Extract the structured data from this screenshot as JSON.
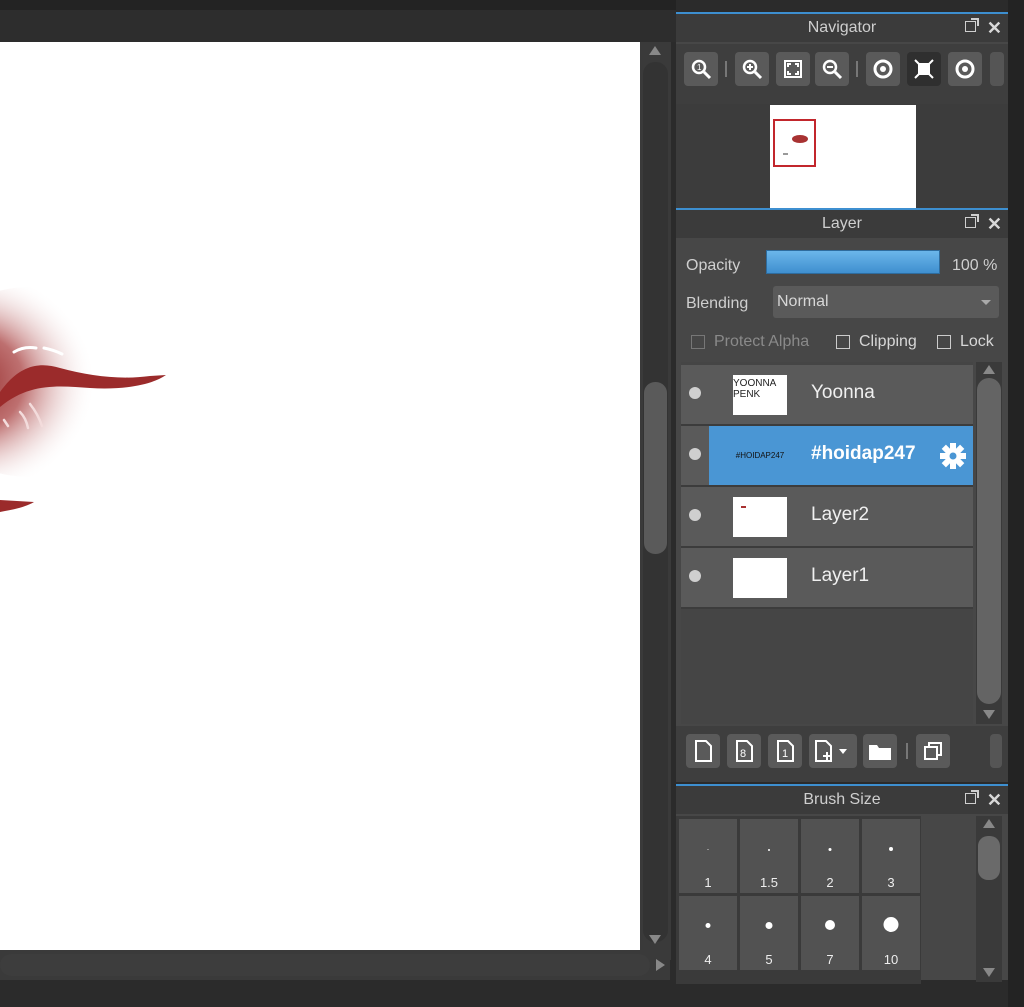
{
  "navigator": {
    "title": "Navigator",
    "tools": [
      "zoom-actual-icon",
      "zoom-in-icon",
      "fit-icon",
      "zoom-out-icon",
      "rotate-left-icon",
      "reset-view-icon",
      "rotate-right-icon"
    ]
  },
  "layer_panel": {
    "title": "Layer",
    "opacity_label": "Opacity",
    "opacity_value": "100 %",
    "blending_label": "Blending",
    "blending_value": "Normal",
    "protect_alpha": "Protect Alpha",
    "clipping": "Clipping",
    "lock": "Lock",
    "layers": [
      {
        "name": "Yoonna",
        "thumb_text_1": "YOONNA",
        "thumb_text_2": "PENK",
        "selected": false
      },
      {
        "name": "#hoidap247",
        "thumb_text_1": "#HOIDAP247",
        "selected": true
      },
      {
        "name": "Layer2",
        "selected": false
      },
      {
        "name": "Layer1",
        "selected": false
      }
    ]
  },
  "brush_panel": {
    "title": "Brush Size",
    "sizes": [
      "1",
      "1.5",
      "2",
      "3",
      "4",
      "5",
      "7",
      "10"
    ]
  },
  "colors": {
    "accent": "#4a96d4",
    "panel": "#474747",
    "lip": "#9b2b2b"
  }
}
